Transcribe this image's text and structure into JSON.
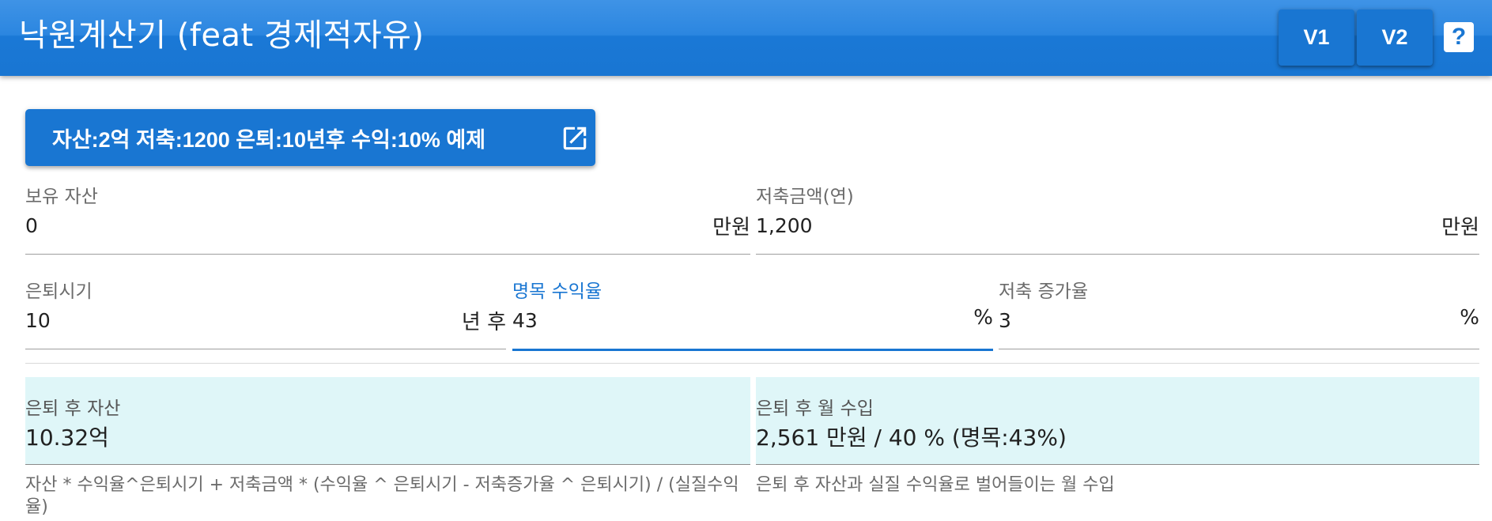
{
  "header": {
    "title": "낙원계산기 (feat 경제적자유)",
    "v1_label": "V1",
    "v2_label": "V2",
    "help_label": "?"
  },
  "example_button": {
    "label": "자산:2억 저축:1200 은퇴:10년후 수익:10% 예제",
    "icon": "open-in-new-icon"
  },
  "fields": {
    "assets": {
      "label": "보유 자산",
      "value": "0",
      "suffix": "만원"
    },
    "savings": {
      "label": "저축금액(연)",
      "value": "1,200",
      "suffix": "만원"
    },
    "retire": {
      "label": "은퇴시기",
      "value": "10",
      "suffix": "년 후"
    },
    "return_rate": {
      "label": "명목 수익율",
      "value": "43",
      "suffix": "%"
    },
    "growth": {
      "label": "저축 증가율",
      "value": "3",
      "suffix": "%"
    }
  },
  "results": {
    "assets": {
      "label": "은퇴 후 자산",
      "value": "10.32억",
      "hint": "자산 * 수익율^은퇴시기 + 저축금액 * (수익율 ^ 은퇴시기 - 저축증가율 ^ 은퇴시기) / (실질수익율)"
    },
    "income": {
      "label": "은퇴 후 월 수입",
      "value": "2,561 만원 / 40 % (명목:43%)",
      "hint": "은퇴 후 자산과 실질 수익율로 벌어들이는 월 수입"
    }
  },
  "colors": {
    "primary": "#1976d2",
    "result_bg": "#dff6f8"
  }
}
